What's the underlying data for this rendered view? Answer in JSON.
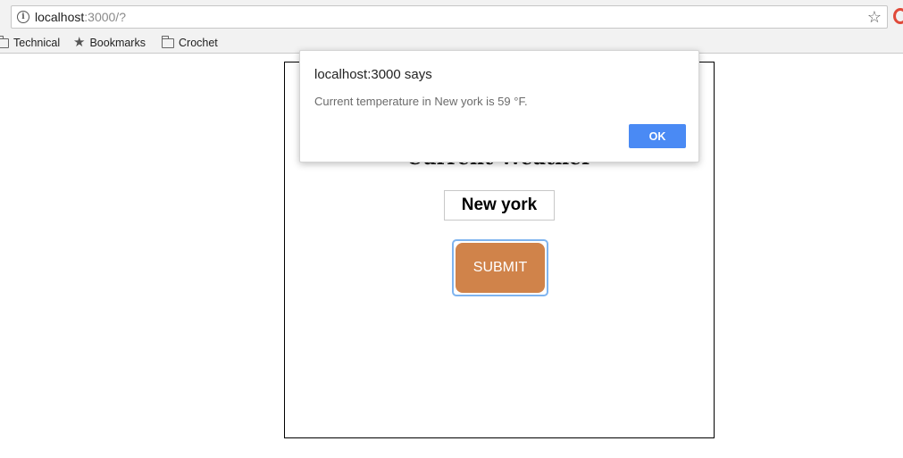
{
  "browser": {
    "url_host": "localhost",
    "url_rest": ":3000/?",
    "bookmarks": [
      {
        "label": "Technical",
        "icon": "folder-icon"
      },
      {
        "label": "Bookmarks",
        "icon": "star-icon"
      },
      {
        "label": "Crochet",
        "icon": "folder-icon"
      }
    ]
  },
  "page": {
    "title": "Current Weather",
    "city_value": "New york",
    "submit_label": "SUBMIT",
    "accent_color": "#d0834a"
  },
  "alert": {
    "title": "localhost:3000 says",
    "message": "Current temperature in New york is 59 °F.",
    "ok_label": "OK",
    "button_color": "#4a8af4"
  }
}
